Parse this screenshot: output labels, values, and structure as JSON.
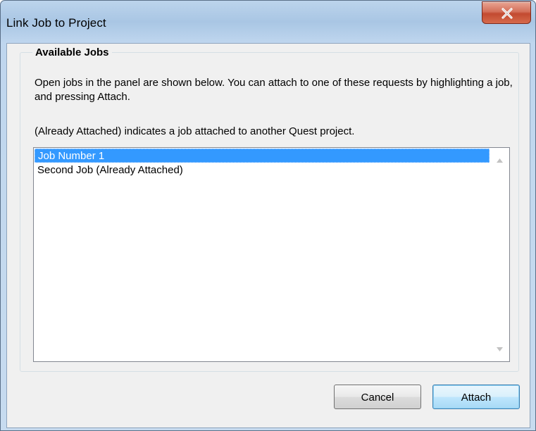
{
  "window": {
    "title": "Link Job to Project"
  },
  "group": {
    "legend": "Available Jobs",
    "description_1": "Open jobs in the panel are shown below. You can attach to one of these requests by highlighting a job, and pressing Attach.",
    "description_2": "(Already Attached) indicates a job attached to another Quest project."
  },
  "jobs_list": {
    "items": [
      {
        "label": "Job Number 1",
        "selected": true
      },
      {
        "label": "Second Job (Already Attached)",
        "selected": false
      }
    ]
  },
  "buttons": {
    "cancel_label": "Cancel",
    "attach_label": "Attach"
  },
  "icons": {
    "close": "close-x-icon",
    "scroll_up": "triangle-up-icon",
    "scroll_down": "triangle-down-icon"
  },
  "colors": {
    "selection": "#3399ff",
    "close_button": "#c7533a",
    "default_button_border": "#3c7fb1"
  }
}
